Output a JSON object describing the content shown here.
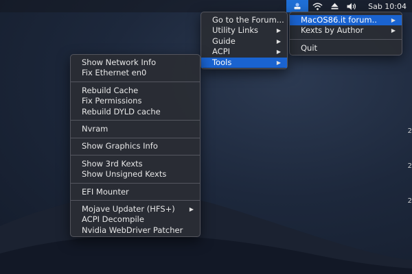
{
  "menubar": {
    "app_icon": "forum-tool-icon",
    "wifi_icon": "wifi-icon",
    "eject_icon": "eject-icon",
    "volume_icon": "volume-icon",
    "clock": "Sab 10:04"
  },
  "main_menu": {
    "items": [
      {
        "label": "MacOS86.it forum..",
        "arrow": "▶"
      },
      {
        "label": "Kexts by Author",
        "arrow": "▶"
      },
      {
        "label": "Quit"
      }
    ]
  },
  "forum_menu": {
    "items": [
      {
        "label": "Go to the Forum..."
      },
      {
        "label": "Utility Links",
        "arrow": "▶"
      },
      {
        "label": "Guide",
        "arrow": "▶"
      },
      {
        "label": "ACPI",
        "arrow": "▶"
      },
      {
        "label": "Tools",
        "arrow": "▶"
      }
    ]
  },
  "tools_menu": {
    "items": [
      "Show Network Info",
      "Fix Ethernet en0",
      "Rebuild Cache",
      "Fix Permissions",
      "Rebuild DYLD cache",
      "Nvram",
      "Show Graphics Info",
      "Show 3rd Kexts",
      "Show Unsigned Kexts",
      "EFI Mounter",
      "Mojave Updater (HFS+)",
      "ACPI Decompile",
      "Nvidia WebDriver Patcher"
    ],
    "mojave_arrow": "▶"
  },
  "desktop_edge": [
    "2",
    "2",
    "2"
  ]
}
